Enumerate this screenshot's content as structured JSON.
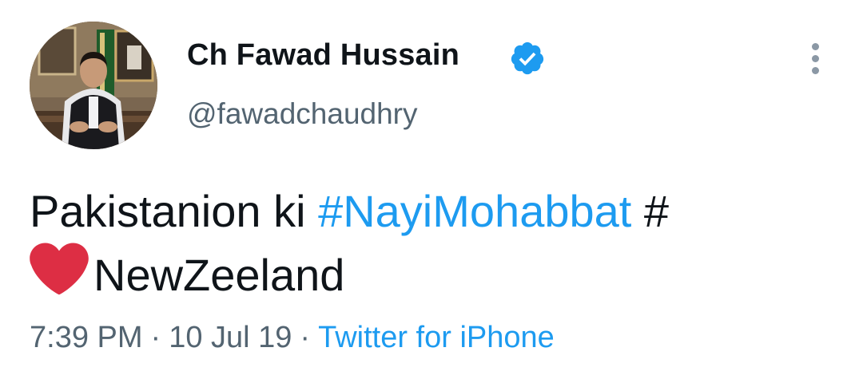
{
  "author": {
    "display_name": "Ch Fawad Hussain",
    "handle": "@fawadchaudhry",
    "verified": true
  },
  "tweet": {
    "text_1": "Pakistanion ki ",
    "hashtag": "#NayiMohabbat",
    "text_2": " #",
    "text_3": "NewZeeland",
    "heart_emoji": "red-heart"
  },
  "meta": {
    "time": "7:39 PM",
    "separator": "·",
    "date": "10 Jul 19",
    "source": "Twitter for iPhone"
  },
  "colors": {
    "link": "#1d9bf0",
    "text": "#0f1419",
    "secondary": "#536471",
    "heart": "#dd2e44"
  }
}
